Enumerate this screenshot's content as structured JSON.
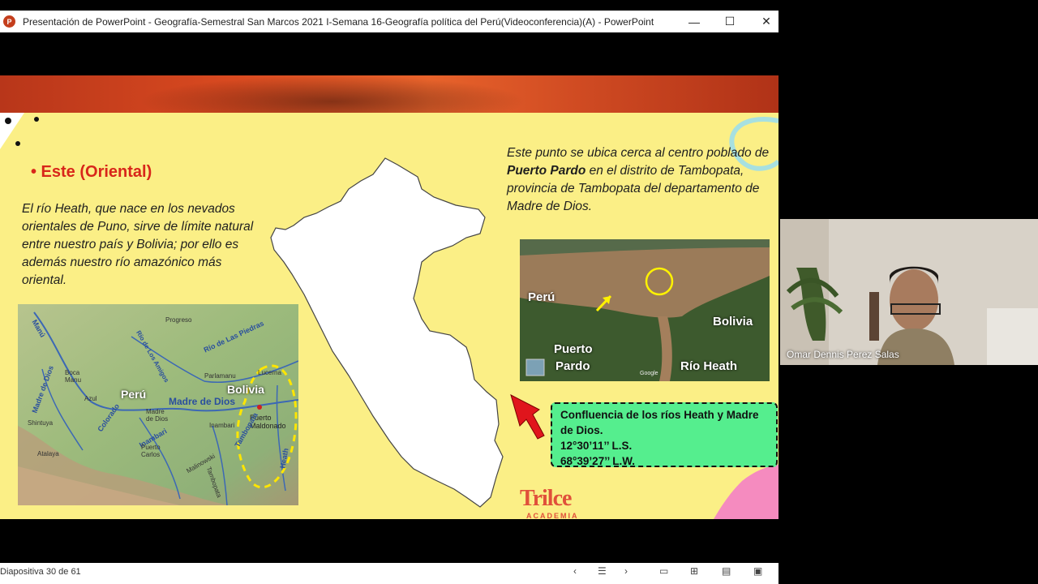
{
  "window": {
    "app_icon_letter": "P",
    "title": "Presentación de PowerPoint  -  Geografía-Semestral San Marcos 2021 I-Semana 16-Geografía política del Perú(Videoconferencia)(A) - PowerPoint",
    "minimize": "—",
    "maximize": "☐",
    "close": "✕"
  },
  "slide": {
    "heading": "• Este (Oriental)",
    "left_paragraph": "El río Heath, que nace en los nevados orientales de Puno,  sirve de límite natural entre nuestro país y Bolivia; por ello es además nuestro río amazónico más oriental.",
    "right_paragraph": {
      "part1": "Este punto se ubica cerca al centro poblado de ",
      "bold": "Puerto Pardo",
      "part2": " en el distrito de Tambopata, provincia de Tambopata del departamento de Madre de Dios."
    },
    "left_map": {
      "labels": {
        "peru": "Perú",
        "bolivia": "Bolivia",
        "madre_de_dios": "Madre de Dios",
        "puerto_maldonado": "Puerto Maldonado",
        "rio_las_piedras": "Río de Las Piedras",
        "manu": "Manú",
        "madre_de_dios_river": "Madre de Dios",
        "inambari": "Inambari",
        "colorado": "Colorado",
        "tambopata": "Tambopata",
        "heath": "Heath",
        "los_amigos": "Río de Los Amigos"
      },
      "towns": [
        "Progreso",
        "Boca Manu",
        "Parlamanu",
        "Lucerna",
        "Shintuya",
        "Inambari",
        "Puerto Carlos",
        "Atalaya",
        "Madre de Dios",
        "Azul",
        "Malinowski",
        "Tambopata"
      ]
    },
    "satellite": {
      "peru": "Perú",
      "bolivia": "Bolivia",
      "puerto": "Puerto",
      "pardo": "Pardo",
      "rio_heath": "Río Heath",
      "google": "Google"
    },
    "callout": {
      "line1": "Confluencia de los ríos Heath y Madre de Dios.",
      "line2": "12°30’11’’ L.S.",
      "line3": "68°39’27’’ L.W."
    },
    "brand": "Trilce",
    "brand_sub": "ACADEMIA"
  },
  "statusbar": {
    "slide_counter": "Diapositiva 30 de 61"
  },
  "video": {
    "participant_name": "Omar Dennis Perez Salas"
  },
  "colors": {
    "slide_bg": "#fbef86",
    "heading": "#d8261a",
    "callout_bg": "#55ee8e",
    "brand": "#e0503a"
  }
}
